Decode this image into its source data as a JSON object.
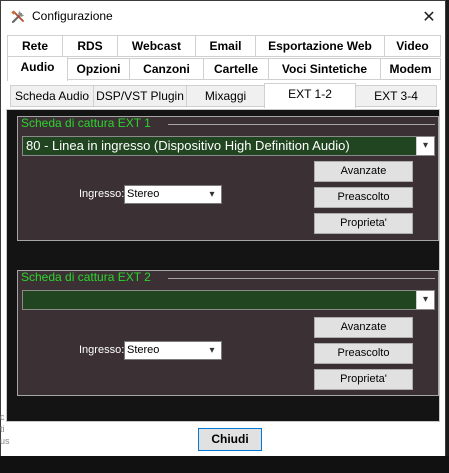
{
  "window": {
    "title": "Configurazione",
    "close_glyph": "✕",
    "icon": "tools-icon"
  },
  "tabs_row1": [
    "Rete",
    "RDS",
    "Webcast",
    "Email",
    "Esportazione Web",
    "Video"
  ],
  "tabs_row2": [
    "Audio",
    "Opzioni",
    "Canzoni",
    "Cartelle",
    "Voci Sintetiche",
    "Modem"
  ],
  "tabs_row2_active": "Audio",
  "subtabs": [
    "Scheda Audio",
    "DSP/VST Plugin",
    "Mixaggi",
    "EXT 1-2",
    "EXT 3-4"
  ],
  "subtabs_active": "EXT 1-2",
  "ext1": {
    "title": "Scheda di cattura EXT 1",
    "device": "80 - Linea in ingresso (Dispositivo High Definition Audio)",
    "input_label": "Ingresso:",
    "input_value": "Stereo",
    "btn_advanced": "Avanzate",
    "btn_prelisten": "Preascolto",
    "btn_properties": "Proprieta'"
  },
  "ext2": {
    "title": "Scheda di cattura EXT 2",
    "device": "",
    "input_label": "Ingresso:",
    "input_value": "Stereo",
    "btn_advanced": "Avanzate",
    "btn_prelisten": "Preascolto",
    "btn_properties": "Proprieta'"
  },
  "footer": {
    "close_label": "Chiudi"
  },
  "background_fragments": [
    "c",
    "ti",
    "us"
  ],
  "colors": {
    "group_title": "#2bd42b",
    "group_bg": "#3b3135",
    "device_bg": "#214521",
    "focus_border": "#0078d7"
  }
}
